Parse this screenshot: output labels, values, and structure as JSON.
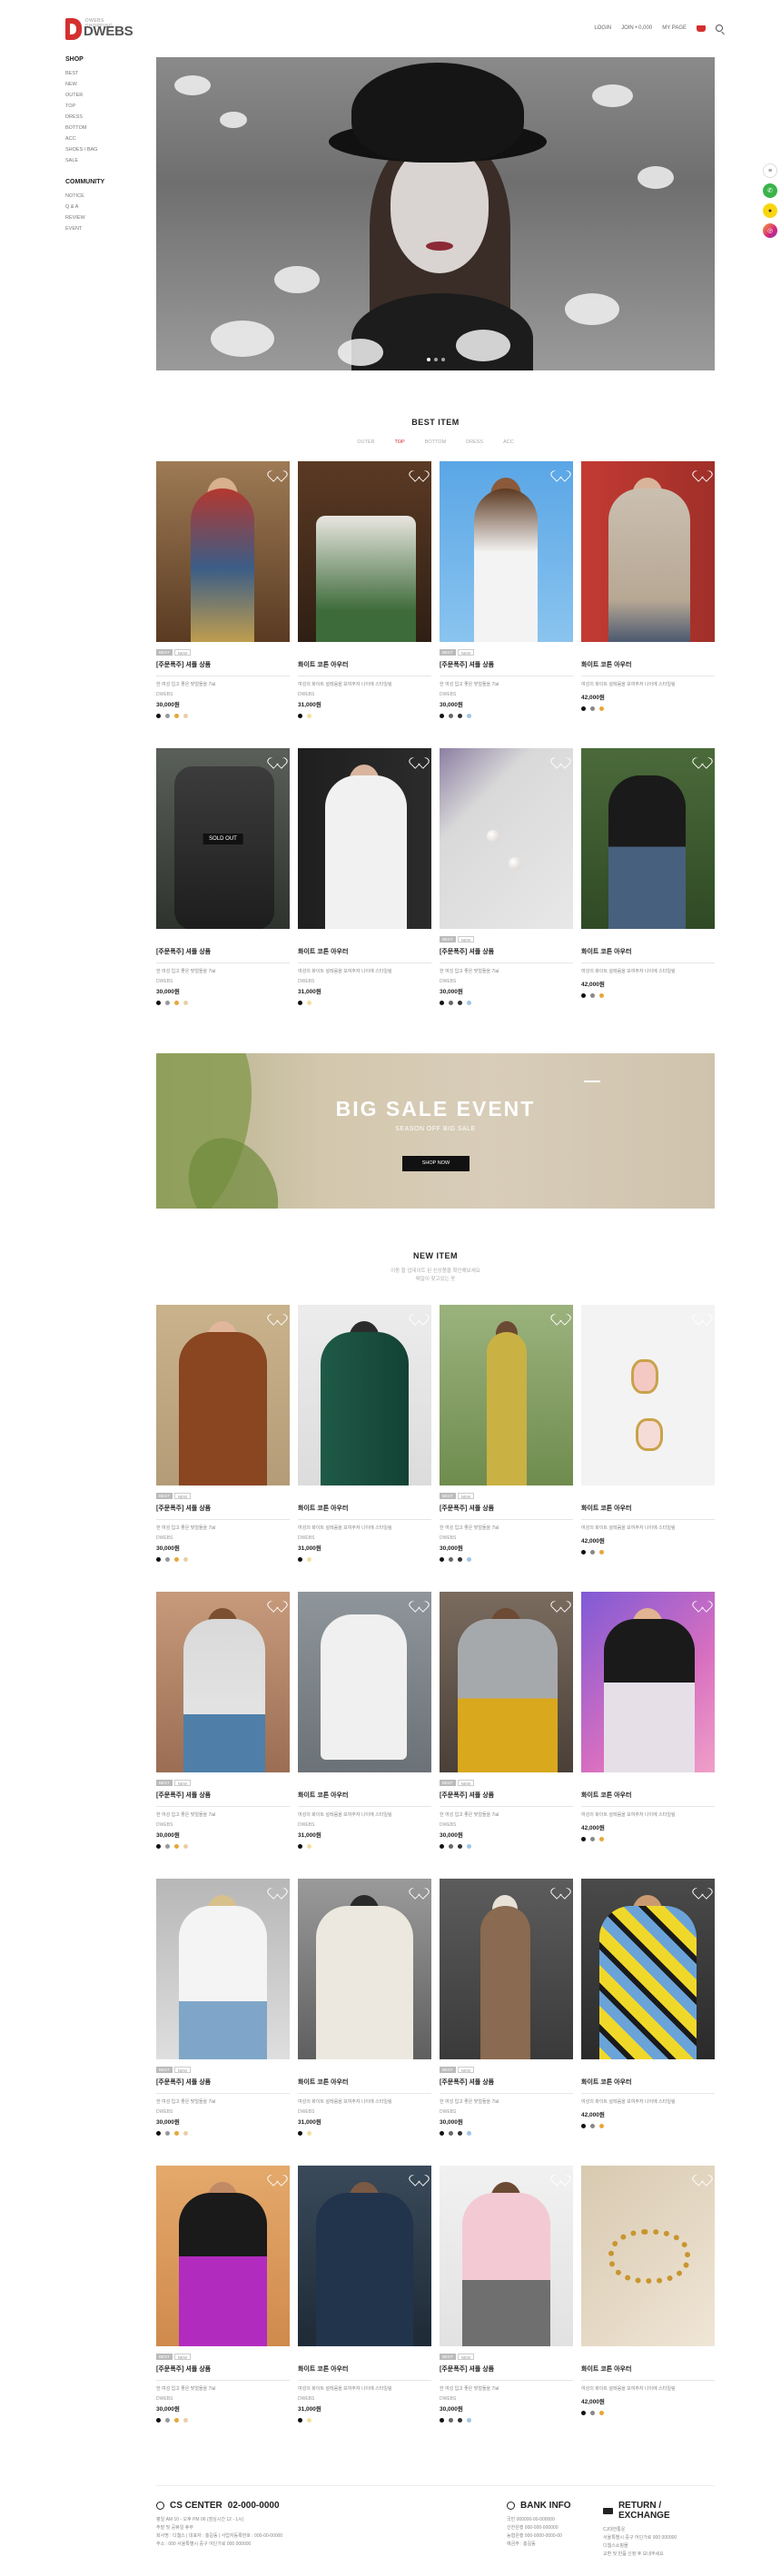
{
  "header": {
    "logo_text": "DWEBS",
    "logo_sub": "DWEBS SHOPPING",
    "util_links": [
      "LOGIN",
      "JOIN • 0,000",
      "MY PAGE"
    ]
  },
  "sidenav": {
    "shop_title": "SHOP",
    "shop_items": [
      "BEST",
      "NEW",
      "OUTER",
      "TOP",
      "DRESS",
      "BOTTOM",
      "ACC",
      "SHOES / BAG",
      "SALE"
    ],
    "community_title": "COMMUNITY",
    "community_items": [
      "NOTICE",
      "Q & A",
      "REVIEW",
      "EVENT"
    ]
  },
  "best": {
    "title": "BEST ITEM",
    "tabs": [
      "OUTER",
      "TOP",
      "BOTTOM",
      "DRESS",
      "ACC"
    ],
    "active_tab": 1
  },
  "new": {
    "title": "NEW ITEM",
    "desc_lines": [
      "이동 할 업데이트 된 신상품을 확인해보세요",
      "매일이 찾고있는 옷"
    ]
  },
  "banner": {
    "title": "BIG SALE EVENT",
    "subtitle": "SEASON OFF BIG SALE",
    "button": "SHOP NOW"
  },
  "products": {
    "a": {
      "name": "[주문폭주] 셔플 상품",
      "desc": "한 여성 입고 좋은 맞얼돌을 7lal",
      "brand": "DWEBS",
      "price": "30,000원"
    },
    "b": {
      "name": "화이트 코튼 아우터",
      "desc": "여성의 화이트 설레움을 보여주자 나이에 스타일링",
      "brand": "DWEBS",
      "price": "31,000원"
    },
    "c": {
      "name": "[주문폭주] 셔플 상품",
      "desc": "한 여성 입고 좋은 맞얼돌을 7lal",
      "brand": "DWEBS",
      "price": "30,000원"
    },
    "d": {
      "name": "화이트 코튼 아우터",
      "desc": "여성의 화이트 설레움을 보여주자 나이에 스타일링",
      "brand": "",
      "price": "42,000원"
    }
  },
  "badges": {
    "sale": "BEST",
    "new": "NEW"
  },
  "soldout": "SOLD OUT",
  "footer": {
    "cs_title": "CS CENTER",
    "cs_number": "02-000-0000",
    "cs_lines": [
      "평일 AM 10 - 오후 PM 06 (점심시간 12 - 1시)",
      "주말 및 공휴일 휴무"
    ],
    "cs_addr": [
      "회사명 : 디웹스 | 대표자 : 홍길동 | 사업자등록번호 : 000-00-00000",
      "주소 : 000 서울특별시 중구 어딘가로 000 000000"
    ],
    "bank_title": "BANK INFO",
    "bank_lines": [
      "국민 000000-00-000000",
      "신한은행 000-000-000000",
      "농협은행 000-0000-0000-00",
      "예금주 : 홍길동"
    ],
    "return_title": "RETURN / EXCHANGE",
    "return_lines": [
      "CJ대한통운",
      "서울특별시 중구 어딘가로 000 000000",
      "디웹스쇼핑몰",
      "교환 및 반품 신청 후 보내주세요"
    ]
  }
}
